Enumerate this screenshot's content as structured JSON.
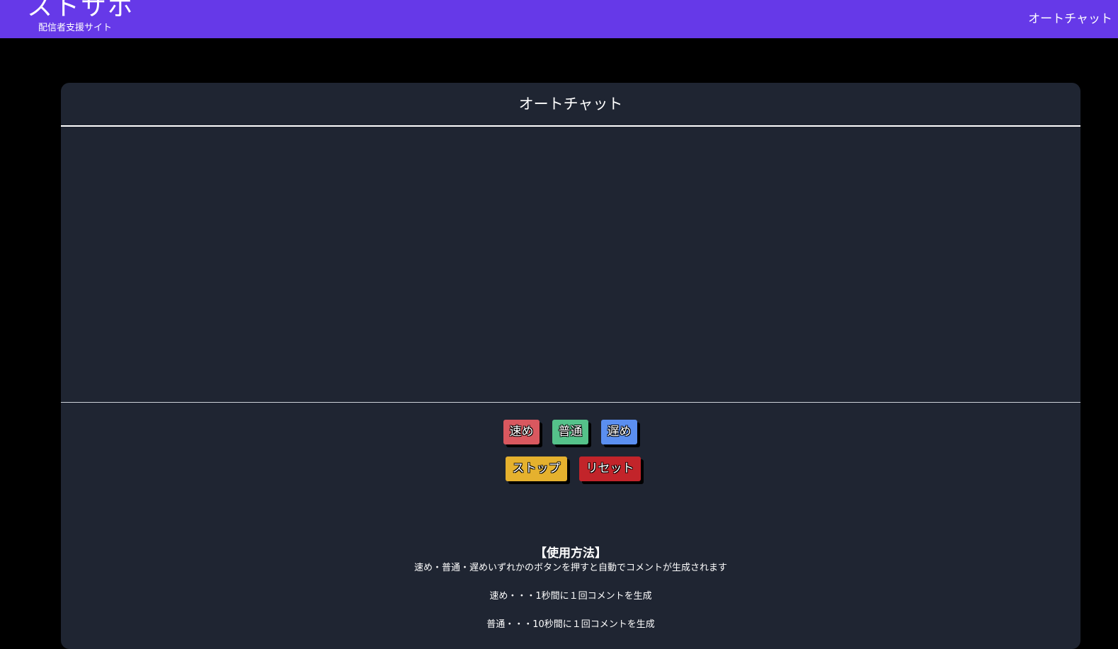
{
  "header": {
    "logo_text": "ストサポ",
    "logo_subtitle": "配信者支援サイト",
    "nav_link": "オートチャット"
  },
  "card": {
    "title": "オートチャット"
  },
  "controls": {
    "fast_label": "速め",
    "normal_label": "普通",
    "slow_label": "遅め",
    "stop_label": "ストップ",
    "reset_label": "リセット"
  },
  "usage": {
    "title": "【使用方法】",
    "intro": "速め・普通・遅めいずれかのボタンを押すと自動でコメントが生成されます",
    "fast_desc": "速め・・・1秒間に１回コメントを生成",
    "normal_desc": "普通・・・10秒間に１回コメントを生成"
  },
  "colors": {
    "header_bg": "#6639e8",
    "page_bg": "#000000",
    "card_bg": "#1f2532",
    "fast": "#d9585f",
    "normal": "#55c28a",
    "slow": "#5b8ff0",
    "stop": "#e5b12e",
    "reset": "#c2242a"
  }
}
